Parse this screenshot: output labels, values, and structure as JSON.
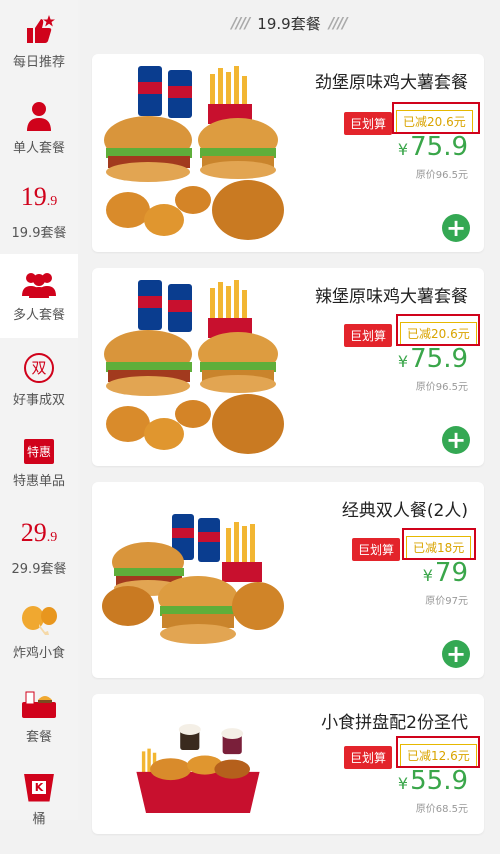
{
  "header": {
    "title": "19.9套餐"
  },
  "sidebar": {
    "items": [
      {
        "label": "每日推荐",
        "icon": "thumbs-up-star-icon"
      },
      {
        "label": "单人套餐",
        "icon": "person-icon"
      },
      {
        "label": "19.9套餐",
        "icon_text": "19",
        "icon_sub": ".9"
      },
      {
        "label": "多人套餐",
        "icon": "group-icon",
        "active": true
      },
      {
        "label": "好事成双",
        "icon": "double-circle-icon",
        "icon_text": "双"
      },
      {
        "label": "特惠单品",
        "icon": "tag-icon",
        "icon_text": "特惠"
      },
      {
        "label": "29.9套餐",
        "icon_text": "29",
        "icon_sub": ".9"
      },
      {
        "label": "炸鸡小食",
        "icon": "drumstick-icon"
      },
      {
        "label": "套餐",
        "icon": "meal-set-icon"
      },
      {
        "label": "桶",
        "icon": "bucket-icon",
        "icon_text": "K"
      }
    ]
  },
  "products": [
    {
      "title": "劲堡原味鸡大薯套餐",
      "badge": "巨划算",
      "saving": "已减20.6元",
      "currency": "¥",
      "price": "75.9",
      "original": "原价96.5元"
    },
    {
      "title": "辣堡原味鸡大薯套餐",
      "badge": "巨划算",
      "saving": "已减20.6元",
      "currency": "¥",
      "price": "75.9",
      "original": "原价96.5元"
    },
    {
      "title": "经典双人餐(2人)",
      "badge": "巨划算",
      "saving": "已减18元",
      "currency": "¥",
      "price": "79",
      "original": "原价97元"
    },
    {
      "title": "小食拼盘配2份圣代",
      "badge": "巨划算",
      "saving": "已减12.6元",
      "currency": "¥",
      "price": "55.9",
      "original": "原价68.5元"
    }
  ],
  "add_label": "+",
  "colors": {
    "accent_red": "#d0021b",
    "price_green": "#3aa64a",
    "add_green": "#34a853",
    "saving_gold": "#d9a400"
  }
}
